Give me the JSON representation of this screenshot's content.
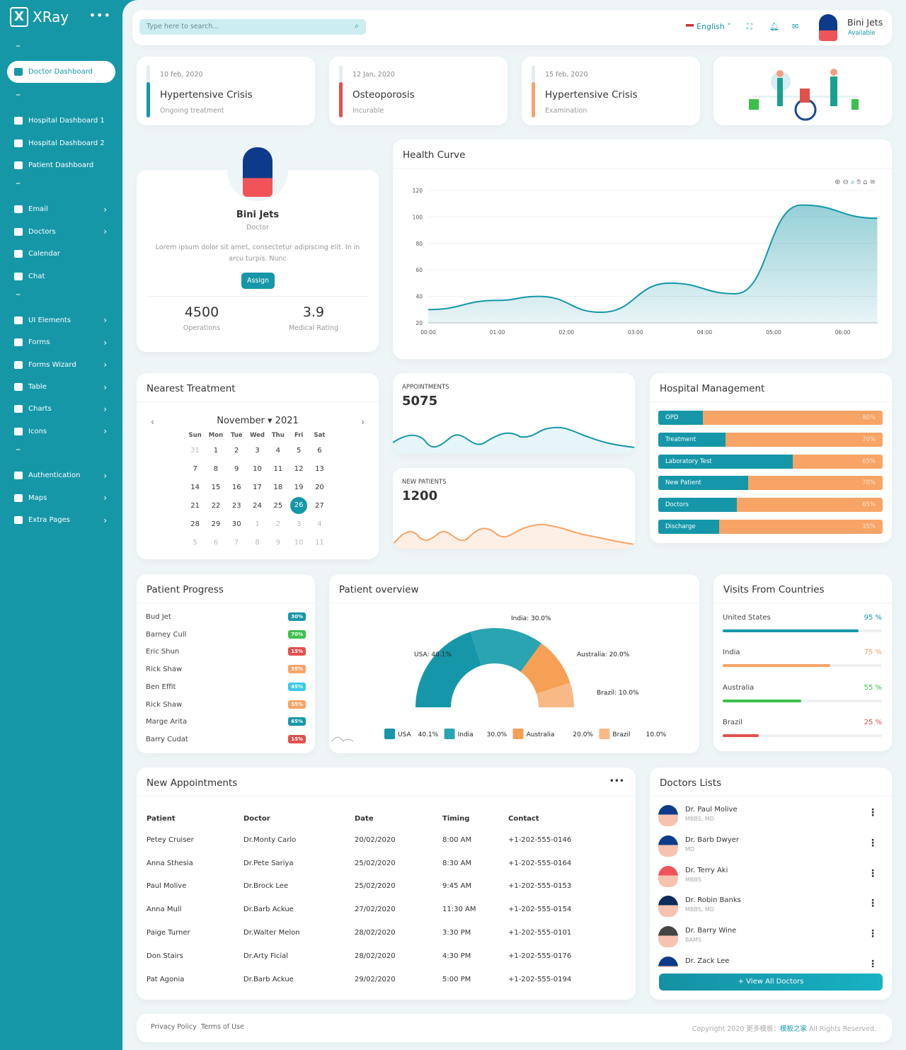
{
  "brand": {
    "name": "XRay"
  },
  "sidebar": {
    "items": [
      {
        "label": "Doctor Dashboard",
        "active": true,
        "icon": "hospital-icon"
      },
      {
        "label": "Hospital Dashboard 1",
        "icon": "home-icon"
      },
      {
        "label": "Hospital Dashboard 2",
        "icon": "briefcase-medical-icon"
      },
      {
        "label": "Patient Dashboard",
        "icon": "users-icon"
      },
      {
        "label": "Email",
        "icon": "mail-icon"
      },
      {
        "label": "Doctors",
        "icon": "user-icon"
      },
      {
        "label": "Calendar",
        "icon": "calendar-icon"
      },
      {
        "label": "Chat",
        "icon": "chat-icon"
      },
      {
        "label": "UI Elements",
        "icon": "grid-icon"
      },
      {
        "label": "Forms",
        "icon": "forms-icon"
      },
      {
        "label": "Forms Wizard",
        "icon": "wizard-icon"
      },
      {
        "label": "Table",
        "icon": "table-icon"
      },
      {
        "label": "Charts",
        "icon": "chart-icon"
      },
      {
        "label": "Icons",
        "icon": "circle-icon"
      },
      {
        "label": "Authentication",
        "icon": "lock-icon"
      },
      {
        "label": "Maps",
        "icon": "map-pin-icon"
      },
      {
        "label": "Extra Pages",
        "icon": "pages-icon"
      }
    ],
    "separator": "–"
  },
  "header": {
    "search_placeholder": "Type here to search...",
    "language": "English",
    "user": {
      "name": "Bini Jets",
      "status": "Available"
    }
  },
  "stats": [
    {
      "date": "10 feb, 2020",
      "title": "Hypertensive Crisis",
      "sub": "Ongoing treatment",
      "color": "#1697a8"
    },
    {
      "date": "12 Jan, 2020",
      "title": "Osteoporosis",
      "sub": "Incurable",
      "color": "#e2504c"
    },
    {
      "date": "15 feb, 2020",
      "title": "Hypertensive Crisis",
      "sub": "Examination",
      "color": "#f7a466"
    }
  ],
  "profile": {
    "name": "Bini Jets",
    "role": "Doctor",
    "bio": "Lorem ipsum dolor sit amet, consectetur adipiscing elit. In in arcu turpis. Nunc",
    "button": "Assign",
    "operations": "4500",
    "operations_label": "Operations",
    "rating": "3.9",
    "rating_label": "Medical Rating"
  },
  "health": {
    "title": "Health Curve"
  },
  "chart_data": {
    "type": "area",
    "title": "Health Curve",
    "x": [
      "00:00",
      "01:00",
      "01:36",
      "02:30",
      "03:30",
      "04:27",
      "05:24",
      "06:30"
    ],
    "values": [
      30,
      37,
      40,
      28,
      50,
      42,
      109,
      99
    ],
    "xticks": [
      "00:00",
      "01:00",
      "02:00",
      "03:00",
      "04:00",
      "05:00",
      "06:00"
    ],
    "yticks": [
      20,
      40,
      60,
      80,
      100,
      120
    ],
    "ylim": [
      20,
      120
    ],
    "color": "#1697a8"
  },
  "treatment": {
    "title": "Nearest Treatment",
    "month": "November",
    "year": "2021",
    "days": [
      "Sun",
      "Mon",
      "Tue",
      "Wed",
      "Thu",
      "Fri",
      "Sat"
    ],
    "weeks": [
      [
        "31",
        "1",
        "2",
        "3",
        "4",
        "5",
        "6"
      ],
      [
        "7",
        "8",
        "9",
        "10",
        "11",
        "12",
        "13"
      ],
      [
        "14",
        "15",
        "16",
        "17",
        "18",
        "19",
        "20"
      ],
      [
        "21",
        "22",
        "23",
        "24",
        "25",
        "26",
        "27"
      ],
      [
        "28",
        "29",
        "30",
        "1",
        "2",
        "3",
        "4"
      ],
      [
        "5",
        "6",
        "7",
        "8",
        "9",
        "10",
        "11"
      ]
    ],
    "selected": "26"
  },
  "appointments": {
    "label": "APPOINTMENTS",
    "value": "5075"
  },
  "new_patients": {
    "label": "NEW PATIENTS",
    "value": "1200"
  },
  "hospital": {
    "title": "Hospital Management",
    "rows": [
      {
        "label": "OPD",
        "fill": 20,
        "pct": "80%"
      },
      {
        "label": "Treatment",
        "fill": 30,
        "pct": "70%"
      },
      {
        "label": "Laboratory Test",
        "fill": 60,
        "pct": "65%"
      },
      {
        "label": "New Patient",
        "fill": 40,
        "pct": "70%"
      },
      {
        "label": "Doctors",
        "fill": 35,
        "pct": "65%"
      },
      {
        "label": "Discharge",
        "fill": 27,
        "pct": "35%"
      }
    ]
  },
  "progress": {
    "title": "Patient Progress",
    "rows": [
      {
        "name": "Bud Jet",
        "pct": "30%",
        "color": "#1697a8"
      },
      {
        "name": "Barney Cull",
        "pct": "70%",
        "color": "#3cc04c"
      },
      {
        "name": "Eric Shun",
        "pct": "15%",
        "color": "#e2504c"
      },
      {
        "name": "Rick Shaw",
        "pct": "55%",
        "color": "#f7a466"
      },
      {
        "name": "Ben Effit",
        "pct": "45%",
        "color": "#3dc9e8"
      },
      {
        "name": "Rick Shaw",
        "pct": "55%",
        "color": "#f7a466"
      },
      {
        "name": "Marge Arita",
        "pct": "65%",
        "color": "#1697a8"
      },
      {
        "name": "Barry Cudat",
        "pct": "15%",
        "color": "#e2504c"
      }
    ]
  },
  "overview": {
    "title": "Patient overview",
    "slices": [
      {
        "name": "USA",
        "value": 40.1,
        "label": "USA: 40.1%",
        "pct": "40.1%",
        "color": "#1597a9"
      },
      {
        "name": "India",
        "value": 30.0,
        "label": "India: 30.0%",
        "pct": "30.0%",
        "color": "#2ba4b1"
      },
      {
        "name": "Australia",
        "value": 20.0,
        "label": "Australia: 20.0%",
        "pct": "20.0%",
        "color": "#f6a055"
      },
      {
        "name": "Brazil",
        "value": 10.0,
        "label": "Brazil: 10.0%",
        "pct": "10.0%",
        "color": "#f8b987"
      }
    ]
  },
  "countries": {
    "title": "Visits From Countries",
    "rows": [
      {
        "name": "United States",
        "pct": "95 %",
        "value": 95,
        "color": "#1697a8"
      },
      {
        "name": "India",
        "pct": "75 %",
        "value": 75,
        "color": "#f7a466"
      },
      {
        "name": "Australia",
        "pct": "55 %",
        "value": 55,
        "color": "#3cc04c"
      },
      {
        "name": "Brazil",
        "pct": "25 %",
        "value": 25,
        "color": "#e2504c"
      }
    ]
  },
  "new_appointments": {
    "title": "New Appointments",
    "columns": [
      "Patient",
      "Doctor",
      "Date",
      "Timing",
      "Contact"
    ],
    "rows": [
      [
        "Petey Cruiser",
        "Dr.Monty Carlo",
        "20/02/2020",
        "8:00 AM",
        "+1-202-555-0146"
      ],
      [
        "Anna Sthesia",
        "Dr.Pete Sariya",
        "25/02/2020",
        "8:30 AM",
        "+1-202-555-0164"
      ],
      [
        "Paul Molive",
        "Dr.Brock Lee",
        "25/02/2020",
        "9:45 AM",
        "+1-202-555-0153"
      ],
      [
        "Anna Mull",
        "Dr.Barb Ackue",
        "27/02/2020",
        "11:30 AM",
        "+1-202-555-0154"
      ],
      [
        "Paige Turner",
        "Dr.Walter Melon",
        "28/02/2020",
        "3:30 PM",
        "+1-202-555-0101"
      ],
      [
        "Don Stairs",
        "Dr.Arty Ficial",
        "28/02/2020",
        "4:30 PM",
        "+1-202-555-0176"
      ],
      [
        "Pat Agonia",
        "Dr.Barb Ackue",
        "29/02/2020",
        "5:00 PM",
        "+1-202-555-0194"
      ]
    ]
  },
  "doctors": {
    "title": "Doctors Lists",
    "button": "+ View All Doctors",
    "items": [
      {
        "name": "Dr. Paul Molive",
        "qual": "MBBS, MD"
      },
      {
        "name": "Dr. Barb Dwyer",
        "qual": "MD"
      },
      {
        "name": "Dr. Terry Aki",
        "qual": "MBBS"
      },
      {
        "name": "Dr. Robin Banks",
        "qual": "MBBS, MD"
      },
      {
        "name": "Dr. Barry Wine",
        "qual": "BAMS"
      },
      {
        "name": "Dr. Zack Lee",
        "qual": ""
      }
    ]
  },
  "footer": {
    "privacy": "Privacy Policy",
    "terms": "Terms of Use",
    "copyright": "Copyright 2020 更多模板：",
    "link": "模板之家",
    "rights": " All Rights Reserved."
  }
}
